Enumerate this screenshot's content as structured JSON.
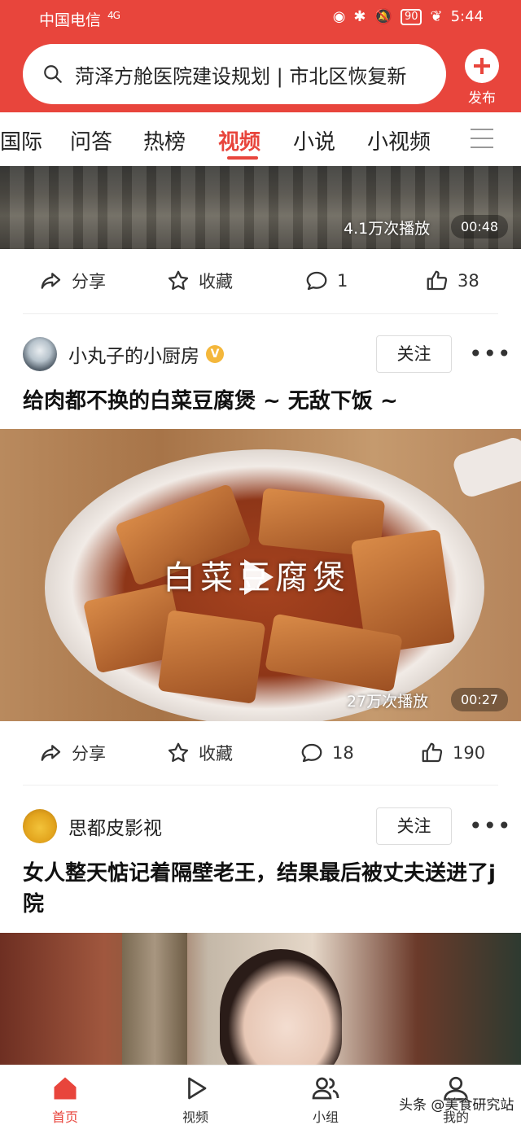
{
  "status_bar": {
    "carrier": "中国电信",
    "signal": "4G",
    "battery": "90",
    "time": "5:44"
  },
  "header": {
    "search_text": "菏泽方舱医院建设规划 | 市北区恢复新",
    "publish_label": "发布"
  },
  "tabs": {
    "items": [
      "国际",
      "问答",
      "热榜",
      "视频",
      "小说",
      "小视频"
    ],
    "active": "视频"
  },
  "feed": {
    "post1": {
      "views": "4.1万次播放",
      "duration": "00:48",
      "share_label": "分享",
      "favorite_label": "收藏",
      "comments": "1",
      "likes": "38"
    },
    "post2": {
      "author": "小丸子的小厨房",
      "follow_label": "关注",
      "title": "给肉都不换的白菜豆腐煲 ~ 无敌下饭 ~",
      "overlay_text": "白菜豆腐煲",
      "views": "27万次播放",
      "duration": "00:27",
      "share_label": "分享",
      "favorite_label": "收藏",
      "comments": "18",
      "likes": "190"
    },
    "post3": {
      "author": "思都皮影视",
      "follow_label": "关注",
      "title": "女人整天惦记着隔壁老王，结果最后被丈夫送进了j院"
    }
  },
  "bottom_nav": {
    "items": [
      "首页",
      "视频",
      "小组",
      "我的"
    ],
    "active": "首页"
  },
  "watermark": "头条 @美食研究站",
  "colors": {
    "brand": "#e8453c",
    "text": "#222222"
  }
}
